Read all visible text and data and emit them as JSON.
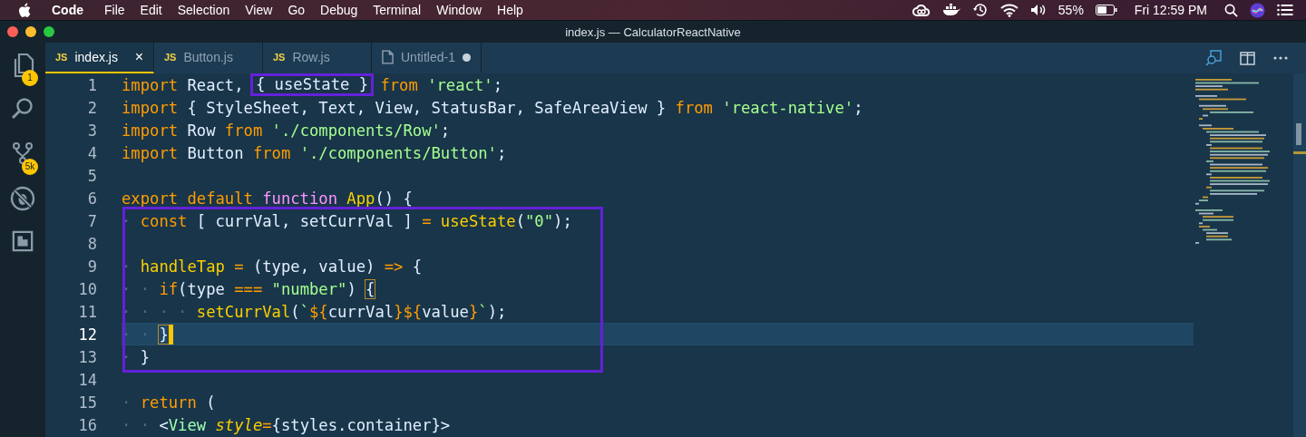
{
  "menu_bar": {
    "app": "Code",
    "items": [
      "File",
      "Edit",
      "Selection",
      "View",
      "Go",
      "Debug",
      "Terminal",
      "Window",
      "Help"
    ],
    "status": {
      "battery_text": "55%",
      "clock": "Fri 12:59 PM"
    }
  },
  "window": {
    "title": "index.js — CalculatorReactNative"
  },
  "activity_bar": [
    {
      "kind": "explorer",
      "badge": "1"
    },
    {
      "kind": "search"
    },
    {
      "kind": "source-control",
      "badge": "5k"
    },
    {
      "kind": "debug"
    },
    {
      "kind": "extensions"
    }
  ],
  "tabs": [
    {
      "kind": "js",
      "badge": "JS",
      "label": "index.js",
      "selected": true,
      "close": "×",
      "dirty": false
    },
    {
      "kind": "js",
      "badge": "JS",
      "label": "Button.js",
      "selected": false,
      "dirty": false
    },
    {
      "kind": "js",
      "badge": "JS",
      "label": "Row.js",
      "selected": false,
      "dirty": false
    },
    {
      "kind": "file",
      "label": "Untitled-1",
      "selected": false,
      "dirty": true
    }
  ],
  "editor": {
    "groups": [
      {
        "boxed": false,
        "lines": [
          {
            "number": "1",
            "current": false,
            "cursor": false,
            "tokens": [
              {
                "kind": "kw",
                "text": "import"
              },
              {
                "kind": "pl",
                "text": " React, "
              },
              {
                "kind": "boxed",
                "text": "{ useState }"
              },
              {
                "kind": "kw",
                "text": " from"
              },
              {
                "kind": "str",
                "text": " 'react'"
              },
              {
                "kind": "pl",
                "text": ";"
              }
            ]
          },
          {
            "number": "2",
            "current": false,
            "cursor": false,
            "tokens": [
              {
                "kind": "kw",
                "text": "import"
              },
              {
                "kind": "pl",
                "text": " { StyleSheet, Text, View, StatusBar, SafeAreaView }"
              },
              {
                "kind": "kw",
                "text": " from"
              },
              {
                "kind": "str",
                "text": " 'react-native'"
              },
              {
                "kind": "pl",
                "text": ";"
              }
            ]
          },
          {
            "number": "3",
            "current": false,
            "cursor": false,
            "tokens": [
              {
                "kind": "kw",
                "text": "import"
              },
              {
                "kind": "pl",
                "text": " Row"
              },
              {
                "kind": "kw",
                "text": " from"
              },
              {
                "kind": "str",
                "text": " './components/Row'"
              },
              {
                "kind": "pl",
                "text": ";"
              }
            ]
          },
          {
            "number": "4",
            "current": false,
            "cursor": false,
            "tokens": [
              {
                "kind": "kw",
                "text": "import"
              },
              {
                "kind": "pl",
                "text": " Button"
              },
              {
                "kind": "kw",
                "text": " from"
              },
              {
                "kind": "str",
                "text": " './components/Button'"
              },
              {
                "kind": "pl",
                "text": ";"
              }
            ]
          },
          {
            "number": "5",
            "current": false,
            "cursor": false
          },
          {
            "number": "6",
            "current": false,
            "cursor": false,
            "tokens": [
              {
                "kind": "kw",
                "text": "export default"
              },
              {
                "kind": "fn",
                "text": " function"
              },
              {
                "kind": "name",
                "text": " App"
              },
              {
                "kind": "pl",
                "text": "() {"
              }
            ]
          }
        ]
      },
      {
        "boxed": true,
        "lines": [
          {
            "number": "7",
            "current": false,
            "cursor": false,
            "tokens": [
              {
                "kind": "ws",
                "text": "·"
              },
              {
                "kind": "kw",
                "text": " const"
              },
              {
                "kind": "pl",
                "text": " [ currVal, setCurrVal ]"
              },
              {
                "kind": "op",
                "text": " ="
              },
              {
                "kind": "name",
                "text": " useState"
              },
              {
                "kind": "pl",
                "text": "("
              },
              {
                "kind": "str",
                "text": "\"0\""
              },
              {
                "kind": "pl",
                "text": ");"
              }
            ]
          },
          {
            "number": "8",
            "current": false,
            "cursor": false
          },
          {
            "number": "9",
            "current": false,
            "cursor": false,
            "tokens": [
              {
                "kind": "ws",
                "text": "·"
              },
              {
                "kind": "name",
                "text": " handleTap"
              },
              {
                "kind": "op",
                "text": " ="
              },
              {
                "kind": "pl",
                "text": " (type, value)"
              },
              {
                "kind": "op",
                "text": " =>"
              },
              {
                "kind": "pl",
                "text": " {"
              }
            ]
          },
          {
            "number": "10",
            "current": false,
            "cursor": false,
            "tokens": [
              {
                "kind": "ws",
                "text": "· ·"
              },
              {
                "kind": "kw",
                "text": " if"
              },
              {
                "kind": "pl",
                "text": "(type"
              },
              {
                "kind": "op",
                "text": " ==="
              },
              {
                "kind": "str",
                "text": " \"number\""
              },
              {
                "kind": "pl",
                "text": ") "
              },
              {
                "kind": "match",
                "text": "{"
              }
            ]
          },
          {
            "number": "11",
            "current": false,
            "cursor": false,
            "tokens": [
              {
                "kind": "ws",
                "text": "· · · ·"
              },
              {
                "kind": "name",
                "text": " setCurrVal"
              },
              {
                "kind": "pl",
                "text": "("
              },
              {
                "kind": "str",
                "text": "`"
              },
              {
                "kind": "op",
                "text": "${"
              },
              {
                "kind": "pl",
                "text": "currVal"
              },
              {
                "kind": "op",
                "text": "}${"
              },
              {
                "kind": "pl",
                "text": "value"
              },
              {
                "kind": "op",
                "text": "}"
              },
              {
                "kind": "str",
                "text": "`"
              },
              {
                "kind": "pl",
                "text": ");"
              }
            ]
          },
          {
            "number": "12",
            "current": true,
            "cursor": true,
            "tokens": [
              {
                "kind": "ws",
                "text": "· · "
              },
              {
                "kind": "match",
                "text": "}"
              }
            ]
          },
          {
            "number": "13",
            "current": false,
            "cursor": false,
            "tokens": [
              {
                "kind": "ws",
                "text": "·"
              },
              {
                "kind": "pl",
                "text": " }"
              }
            ]
          }
        ]
      },
      {
        "boxed": false,
        "lines": [
          {
            "number": "14",
            "current": false,
            "cursor": false
          },
          {
            "number": "15",
            "current": false,
            "cursor": false,
            "tokens": [
              {
                "kind": "ws",
                "text": "·"
              },
              {
                "kind": "kw",
                "text": " return"
              },
              {
                "kind": "pl",
                "text": " ("
              }
            ]
          },
          {
            "number": "16",
            "current": false,
            "cursor": false,
            "tokens": [
              {
                "kind": "ws",
                "text": "· ·"
              },
              {
                "kind": "pl",
                "text": " <"
              },
              {
                "kind": "tag",
                "text": "View"
              },
              {
                "kind": "attr",
                "text": " style"
              },
              {
                "kind": "op",
                "text": "="
              },
              {
                "kind": "pl",
                "text": "{styles.container}>"
              }
            ]
          }
        ]
      }
    ]
  }
}
